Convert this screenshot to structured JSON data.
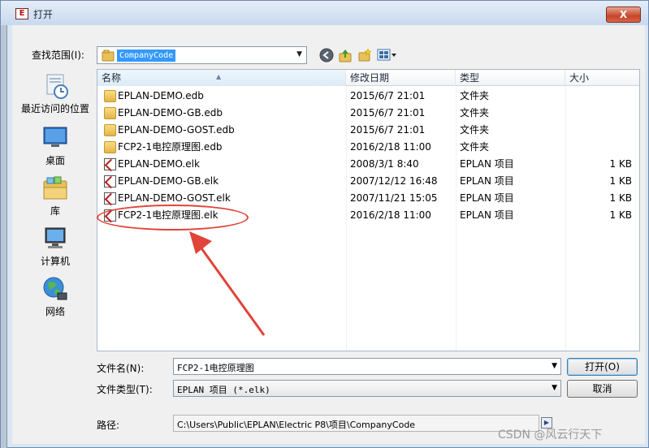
{
  "window": {
    "title": "打开",
    "close_label": "X"
  },
  "lookin": {
    "label": "查找范围(I):",
    "value": "CompanyCode"
  },
  "toolbar": {
    "back_icon": "back-arrow-icon",
    "up_icon": "up-folder-icon",
    "newfolder_icon": "new-folder-icon",
    "views_icon": "views-menu-icon"
  },
  "places": [
    {
      "label": "最近访问的位置",
      "icon": "recent-places-icon"
    },
    {
      "label": "桌面",
      "icon": "desktop-icon"
    },
    {
      "label": "库",
      "icon": "libraries-icon"
    },
    {
      "label": "计算机",
      "icon": "computer-icon"
    },
    {
      "label": "网络",
      "icon": "network-icon"
    }
  ],
  "columns": {
    "name": "名称",
    "date": "修改日期",
    "type": "类型",
    "size": "大小"
  },
  "files": [
    {
      "name": "EPLAN-DEMO.edb",
      "date": "2015/6/7 21:01",
      "type": "文件夹",
      "size": "",
      "icon": "folder-icon"
    },
    {
      "name": "EPLAN-DEMO-GB.edb",
      "date": "2015/6/7 21:01",
      "type": "文件夹",
      "size": "",
      "icon": "folder-icon"
    },
    {
      "name": "EPLAN-DEMO-GOST.edb",
      "date": "2015/6/7 21:01",
      "type": "文件夹",
      "size": "",
      "icon": "folder-icon"
    },
    {
      "name": "FCP2-1电控原理图.edb",
      "date": "2016/2/18 11:00",
      "type": "文件夹",
      "size": "",
      "icon": "folder-icon"
    },
    {
      "name": "EPLAN-DEMO.elk",
      "date": "2008/3/1 8:40",
      "type": "EPLAN 项目",
      "size": "1 KB",
      "icon": "eplan-project-icon"
    },
    {
      "name": "EPLAN-DEMO-GB.elk",
      "date": "2007/12/12 16:48",
      "type": "EPLAN 项目",
      "size": "1 KB",
      "icon": "eplan-project-icon"
    },
    {
      "name": "EPLAN-DEMO-GOST.elk",
      "date": "2007/11/21 15:05",
      "type": "EPLAN 项目",
      "size": "1 KB",
      "icon": "eplan-project-icon"
    },
    {
      "name": "FCP2-1电控原理图.elk",
      "date": "2016/2/18 11:00",
      "type": "EPLAN 项目",
      "size": "1 KB",
      "icon": "eplan-project-icon"
    }
  ],
  "filename": {
    "label": "文件名(N):",
    "value": "FCP2-1电控原理图"
  },
  "filetype": {
    "label": "文件类型(T):",
    "value": "EPLAN 项目 (*.elk)"
  },
  "buttons": {
    "open": "打开(O)",
    "cancel": "取消"
  },
  "path": {
    "label": "路径:",
    "value": "C:\\Users\\Public\\EPLAN\\Electric P8\\项目\\CompanyCode"
  },
  "watermark": "CSDN @风云行天下",
  "colors": {
    "selection": "#3399ff",
    "annotation": "#e0443a",
    "close": "#c7452a"
  }
}
